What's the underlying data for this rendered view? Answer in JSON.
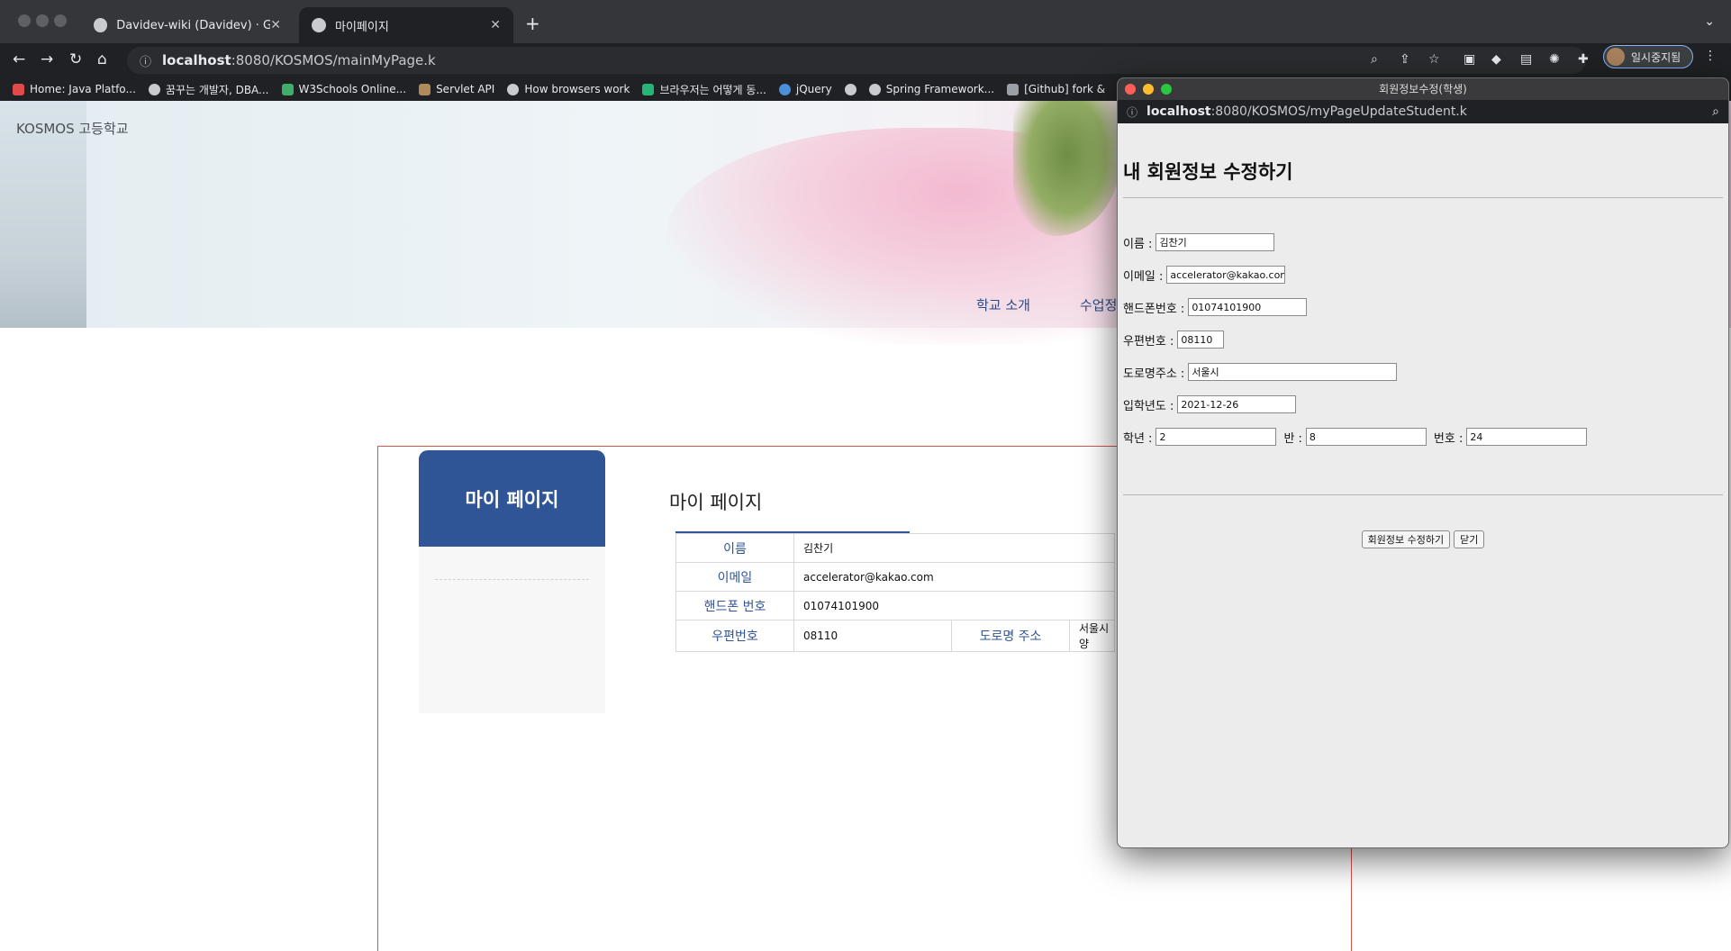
{
  "browser": {
    "tabs": [
      {
        "title": "Davidev-wiki (Davidev) · GitHub",
        "icon": "github-icon"
      },
      {
        "title": "마이페이지",
        "icon": "globe-icon"
      }
    ],
    "url": {
      "host": "localhost",
      "path": ":8080/KOSMOS/mainMyPage.k"
    },
    "profile_label": "일시중지됨",
    "bookmarks": [
      "Home: Java Platfo...",
      "꿈꾸는 개발자, DBA...",
      "W3Schools Online...",
      "Servlet API",
      "How browsers work",
      "브라우저는 어떻게 동...",
      "jQuery",
      "",
      "Spring Framework...",
      "[Github] fork &"
    ]
  },
  "page": {
    "school_name": "KOSMOS 고등학교",
    "nav": [
      "학교 소개",
      "수업정"
    ],
    "sidebar_title": "마이 페이지",
    "title": "마이 페이지",
    "table": {
      "name_label": "이름",
      "name_value": "김찬기",
      "email_label": "이메일",
      "email_value": "accelerator@kakao.com",
      "phone_label": "핸드폰 번호",
      "phone_value": "01074101900",
      "zip_label": "우편번호",
      "zip_value": "08110",
      "road_label": "도로명 주소",
      "road_value": "서울시 양"
    }
  },
  "popup": {
    "window_title": "회원정보수정(학생)",
    "url": {
      "host": "localhost",
      "path": ":8080/KOSMOS/myPageUpdateStudent.k"
    },
    "heading": "내 회원정보 수정하기",
    "fields": {
      "name_label": "이름 :",
      "name_value": "김찬기",
      "email_label": "이메일 :",
      "email_value": "accelerator@kakao.com",
      "phone_label": "핸드폰번호 :",
      "phone_value": "01074101900",
      "zip_label": "우편번호 :",
      "zip_value": "08110",
      "road_label": "도로명주소 :",
      "road_value": "서울시",
      "year_label": "입학년도 :",
      "year_value": "2021-12-26",
      "grade_label": "학년 :",
      "grade_value": "2",
      "class_label": "반 :",
      "class_value": "8",
      "number_label": "번호 :",
      "number_value": "24"
    },
    "submit_label": "회원정보 수정하기",
    "close_label": "닫기"
  }
}
